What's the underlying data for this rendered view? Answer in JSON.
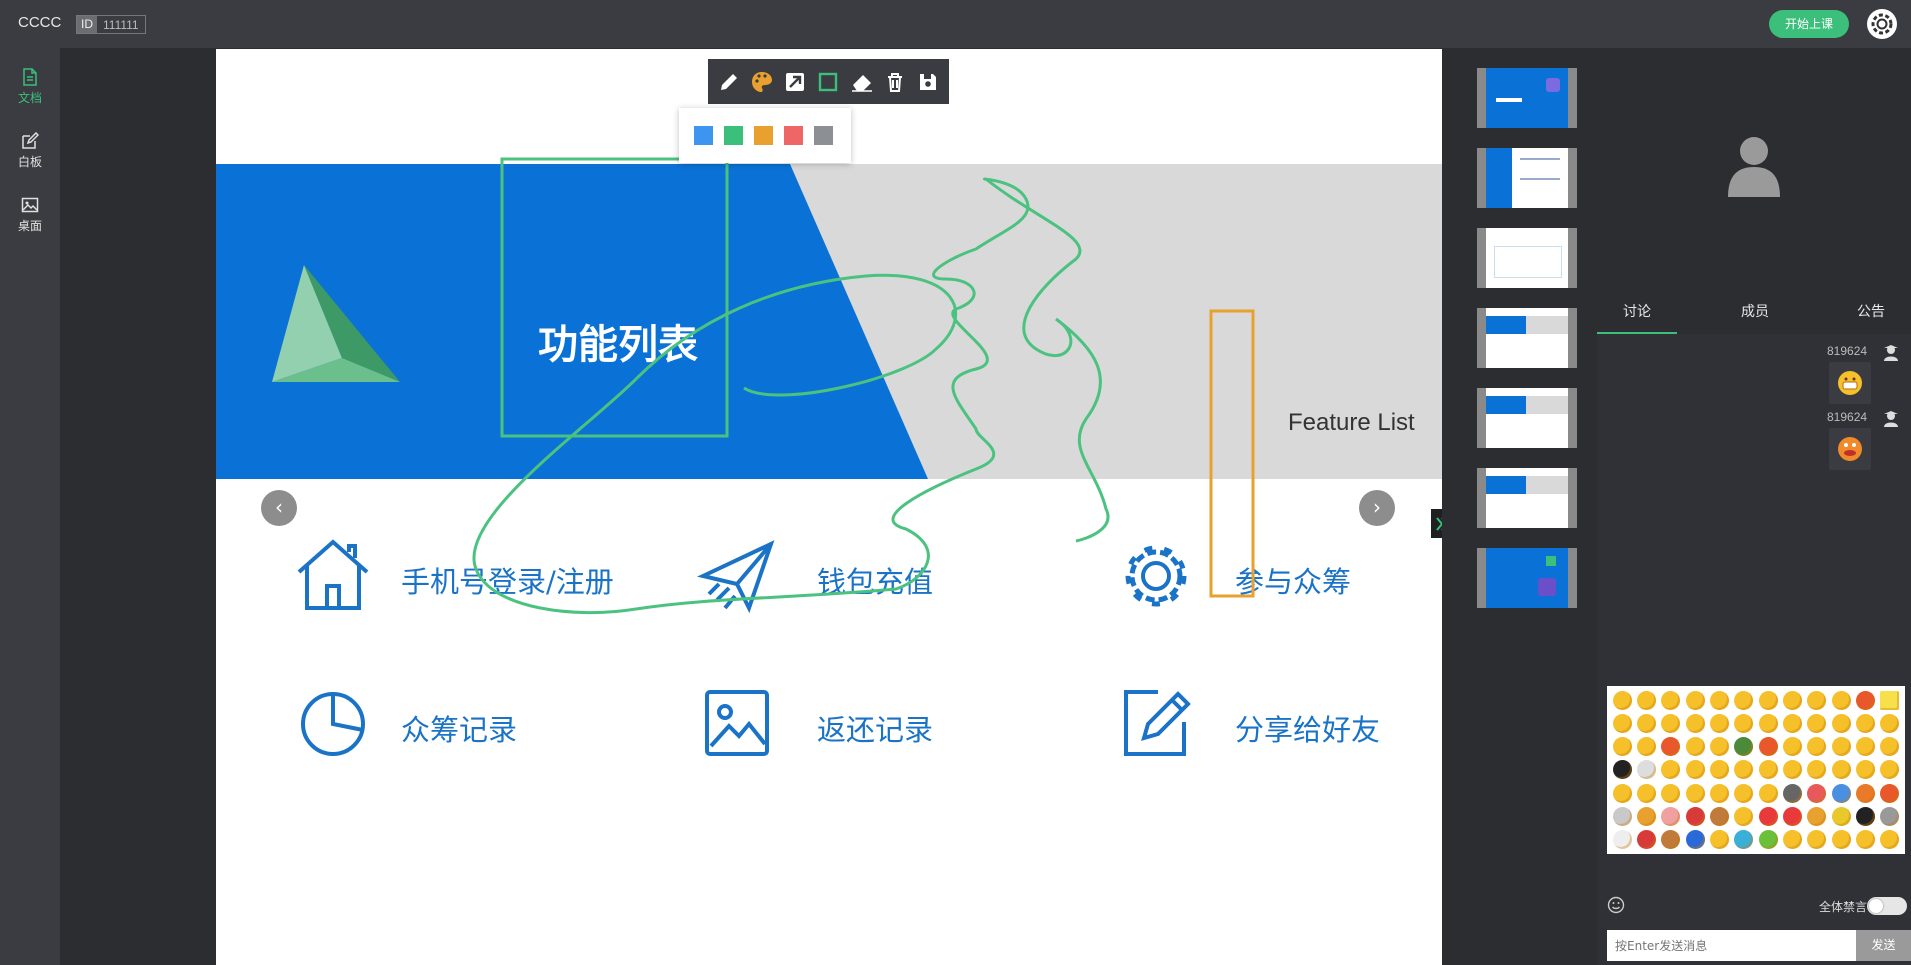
{
  "topbar": {
    "brand": "CCCC",
    "id_label": "ID",
    "id_value": "111111",
    "start_label": "开始上课"
  },
  "leftnav": {
    "items": [
      {
        "label": "文档",
        "icon": "document-icon",
        "active": true
      },
      {
        "label": "白板",
        "icon": "edit-icon",
        "active": false
      },
      {
        "label": "桌面",
        "icon": "image-icon",
        "active": false
      }
    ]
  },
  "slide": {
    "title": "功能列表",
    "subtitle": "Feature List",
    "features": [
      "手机号登录/注册",
      "钱包充值",
      "参与众筹",
      "众筹记录",
      "返还记录",
      "分享给好友"
    ]
  },
  "toolbar": {
    "tools": [
      "pencil-icon",
      "palette-icon",
      "arrow-icon",
      "rectangle-icon",
      "eraser-icon",
      "trash-icon",
      "save-icon"
    ],
    "colors": [
      "#3d95f0",
      "#3bbf7a",
      "#e8a12e",
      "#ef6666",
      "#8c8f94"
    ]
  },
  "right": {
    "tabs": [
      "讨论",
      "成员",
      "公告"
    ],
    "messages": [
      {
        "user": "819624"
      },
      {
        "user": "819624"
      }
    ],
    "mute_label": "全体禁言",
    "input_placeholder": "按Enter发送消息",
    "send_label": "发送"
  },
  "colors": {
    "accent": "#3bbf7a",
    "slide_blue": "#0a72d6"
  }
}
